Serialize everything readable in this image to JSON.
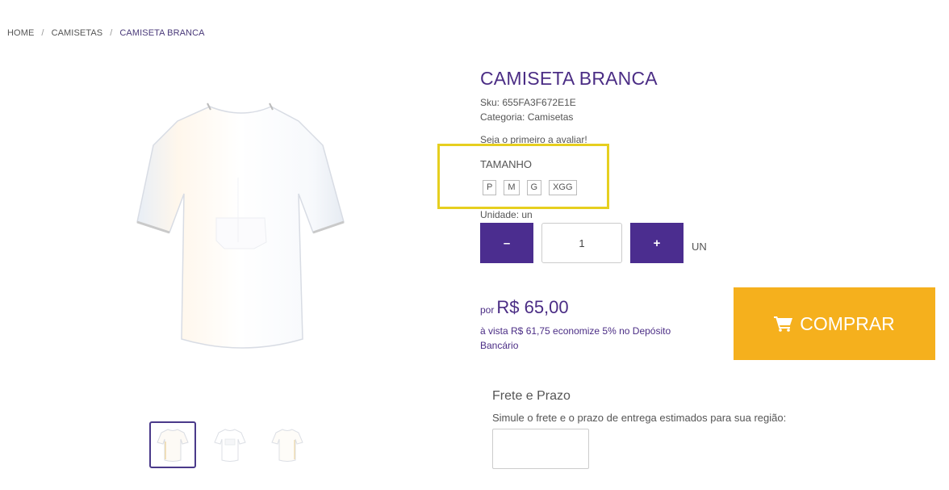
{
  "breadcrumb": {
    "home": "HOME",
    "category": "CAMISETAS",
    "current": "CAMISETA BRANCA",
    "separator": "/"
  },
  "product": {
    "title": "CAMISETA BRANCA",
    "sku": "Sku: 655FA3F672E1E",
    "category": "Categoria: Camisetas",
    "review_link": "Seja o primeiro a avaliar!"
  },
  "variant": {
    "label": "TAMANHO",
    "sizes": [
      "P",
      "M",
      "G",
      "XGG"
    ],
    "highlight_color": "#e6cf1f"
  },
  "quantity": {
    "unit_label": "Unidade: un",
    "minus": "–",
    "plus": "+",
    "value": "1",
    "unit": "UN"
  },
  "price": {
    "prefix": "por",
    "value": "R$ 65,00",
    "discount": "à vista R$ 61,75 economize 5% no Depósito Bancário"
  },
  "buy": {
    "label": "COMPRAR",
    "icon": "cart-icon",
    "color": "#f5b01d"
  },
  "shipping": {
    "title": "Frete e Prazo",
    "description": "Simule o frete e o prazo de entrega estimados para sua região:",
    "cep_value": ""
  },
  "colors": {
    "brand": "#4b2d85",
    "buttons": "#4b2d8f"
  },
  "images": {
    "main": "white-tshirt-image",
    "thumbnails": [
      "white-tshirt-front",
      "white-tshirt-back",
      "white-tshirt-side"
    ]
  }
}
